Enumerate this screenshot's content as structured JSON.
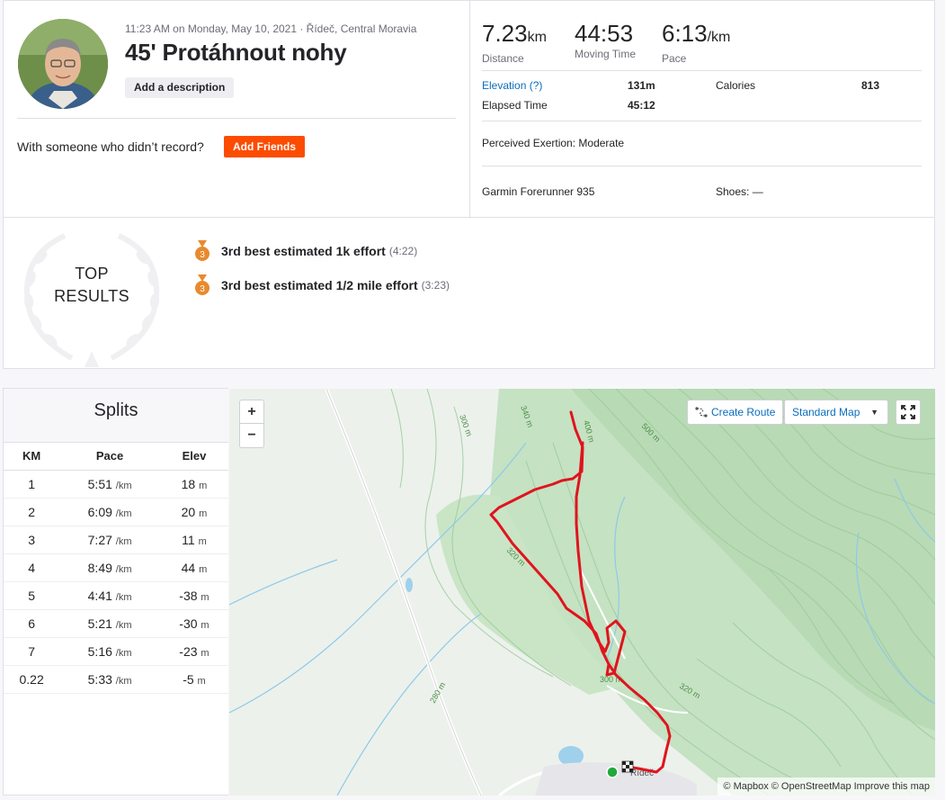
{
  "activity": {
    "meta": "11:23 AM on Monday, May 10, 2021 · Řídeč, Central Moravia",
    "title": "45' Protáhnout nohy",
    "add_description": "Add a description",
    "with_someone": "With someone who didn’t record?",
    "add_friends": "Add Friends"
  },
  "stats": {
    "distance": {
      "value": "7.23",
      "unit": "km",
      "label": "Distance"
    },
    "moving_time": {
      "value": "44:53",
      "label": "Moving Time"
    },
    "pace": {
      "value": "6:13",
      "unit": "/km",
      "label": "Pace"
    },
    "elevation_label": "Elevation (?)",
    "elevation_value": "131m",
    "calories_label": "Calories",
    "calories_value": "813",
    "elapsed_label": "Elapsed Time",
    "elapsed_value": "45:12",
    "exertion_label": "Perceived Exertion:",
    "exertion_value": "Moderate",
    "device": "Garmin Forerunner 935",
    "shoes": "Shoes: —"
  },
  "top_results": {
    "heading_line1": "TOP",
    "heading_line2": "RESULTS",
    "medal_rank": "3",
    "items": [
      {
        "text": "3rd best estimated 1k effort",
        "time": "(4:22)"
      },
      {
        "text": "3rd best estimated 1/2 mile effort",
        "time": "(3:23)"
      }
    ]
  },
  "splits": {
    "title": "Splits",
    "headers": [
      "KM",
      "Pace",
      "Elev"
    ],
    "pace_unit": "/km",
    "elev_unit": "m",
    "rows": [
      {
        "km": "1",
        "pace": "5:51",
        "elev": "18"
      },
      {
        "km": "2",
        "pace": "6:09",
        "elev": "20"
      },
      {
        "km": "3",
        "pace": "7:27",
        "elev": "11"
      },
      {
        "km": "4",
        "pace": "8:49",
        "elev": "44"
      },
      {
        "km": "5",
        "pace": "4:41",
        "elev": "-38"
      },
      {
        "km": "6",
        "pace": "5:21",
        "elev": "-30"
      },
      {
        "km": "7",
        "pace": "5:16",
        "elev": "-23"
      },
      {
        "km": "0.22",
        "pace": "5:33",
        "elev": "-5"
      }
    ]
  },
  "map": {
    "zoom_in": "+",
    "zoom_out": "−",
    "create_route": "Create Route",
    "map_style": "Standard Map",
    "attribution": "© Mapbox © OpenStreetMap Improve this map",
    "place_label": "Řídeč",
    "contour_labels": [
      "300 m",
      "340 m",
      "400 m",
      "500 m",
      "320 m",
      "300 m",
      "320 m",
      "280 m"
    ]
  },
  "colors": {
    "accent": "#fc4c02",
    "route": "#e0141e",
    "link": "#0a6ebd",
    "medal": "#e88a2e"
  }
}
